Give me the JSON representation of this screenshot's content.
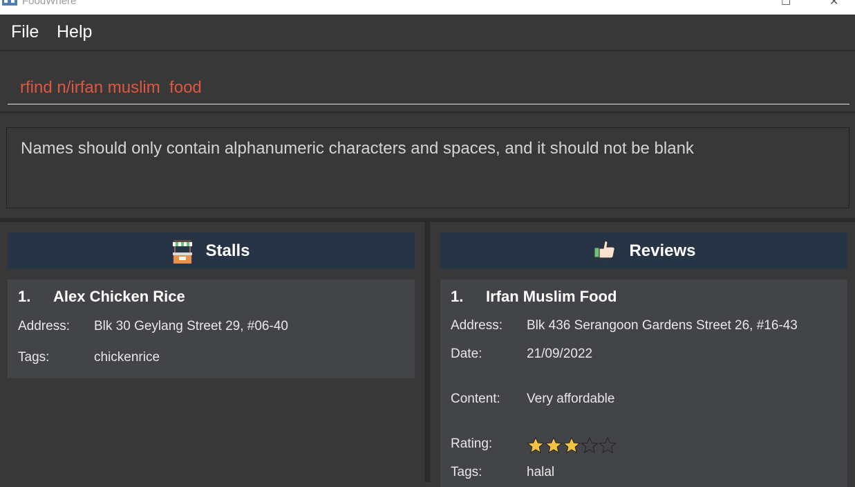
{
  "window": {
    "title": "FoodWhere"
  },
  "menu": {
    "items": [
      {
        "label": "File"
      },
      {
        "label": "Help"
      }
    ]
  },
  "command": {
    "value": "rfind n/irfan muslim  food"
  },
  "result": {
    "message": "Names should only contain alphanumeric characters and spaces, and it should not be blank"
  },
  "stalls": {
    "header": "Stalls",
    "icon": "stall-icon",
    "items": [
      {
        "index": "1.",
        "name": "Alex Chicken Rice",
        "address_label": "Address:",
        "address": "Blk 30 Geylang Street 29, #06-40",
        "tags_label": "Tags:",
        "tags": "chickenrice"
      }
    ]
  },
  "reviews": {
    "header": "Reviews",
    "icon": "thumbs-up-icon",
    "items": [
      {
        "index": "1.",
        "name": "Irfan Muslim Food",
        "address_label": "Address:",
        "address": "Blk 436 Serangoon Gardens Street 26, #16-43",
        "date_label": "Date:",
        "date": "21/09/2022",
        "content_label": "Content:",
        "content": "Very affordable",
        "rating_label": "Rating:",
        "rating": 3,
        "rating_max": 5,
        "tags_label": "Tags:",
        "tags": "halal"
      }
    ]
  },
  "colors": {
    "header_bg": "#263446",
    "command_text": "#e0573f",
    "card_bg": "#434447",
    "star_filled": "#f5c242"
  }
}
